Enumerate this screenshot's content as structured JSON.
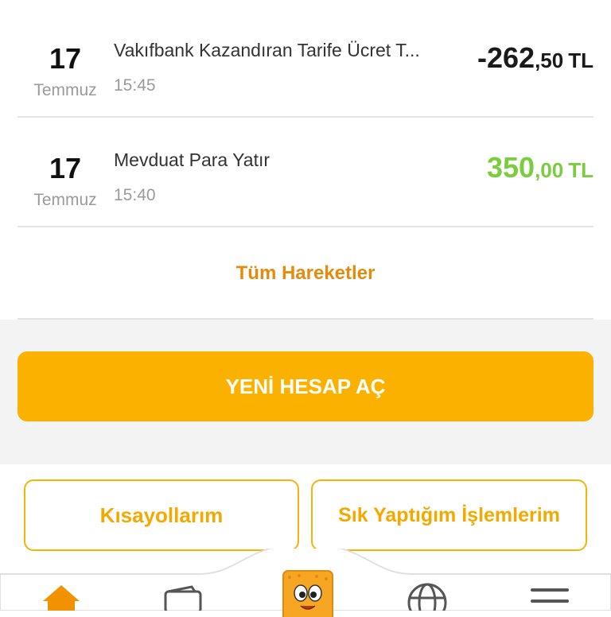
{
  "transactions": [
    {
      "day": "17",
      "month": "Temmuz",
      "title": "Vakıfbank Kazandıran Tarife Ücret T...",
      "time": "15:45",
      "amount_int": "-262",
      "amount_dec": ",50",
      "currency": "TL",
      "direction": "negative"
    },
    {
      "day": "17",
      "month": "Temmuz",
      "title": "Mevduat Para Yatır",
      "time": "15:40",
      "amount_int": "350",
      "amount_dec": ",00",
      "currency": "TL",
      "direction": "positive"
    }
  ],
  "all_transactions_label": "Tüm Hareketler",
  "new_account_label": "YENİ HESAP AÇ",
  "shortcuts": {
    "left_label": "Kısayollarım",
    "right_label": "Sık Yaptığım İşlemlerim"
  },
  "tabbar": {
    "icons": [
      "home-icon",
      "wallet-icon",
      "mascot-icon",
      "globe-icon",
      "menu-icon"
    ]
  },
  "colors": {
    "accent": "#fbb100",
    "link": "#e58a0d",
    "positive": "#7ccd3e",
    "negative": "#1a1a1a"
  }
}
